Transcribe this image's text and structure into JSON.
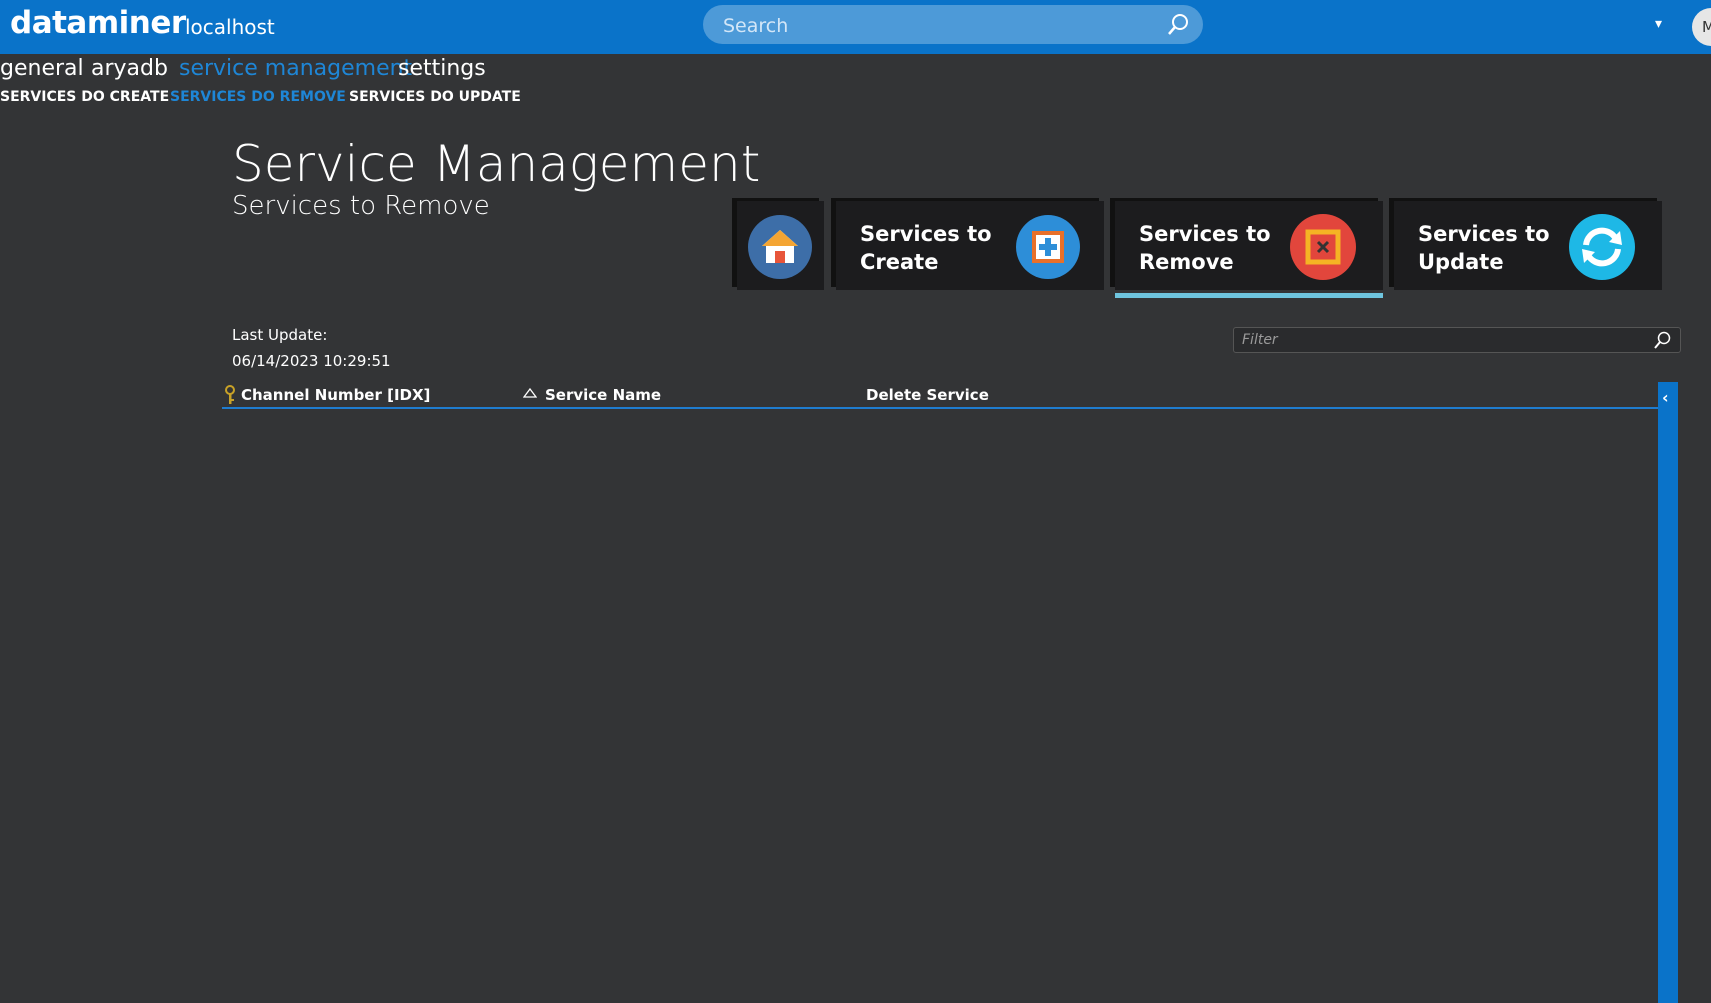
{
  "header": {
    "brand": "dataminer",
    "host": "localhost",
    "search_placeholder": "Search",
    "avatar_initial": "M"
  },
  "nav": {
    "tabs": [
      {
        "label": "general",
        "active": false
      },
      {
        "label": "aryadb",
        "active": false
      },
      {
        "label": "service management",
        "active": true
      },
      {
        "label": "settings",
        "active": false
      }
    ],
    "subtabs": [
      {
        "label": "SERVICES DO CREATE",
        "active": false
      },
      {
        "label": "SERVICES DO REMOVE",
        "active": true
      },
      {
        "label": "SERVICES DO UPDATE",
        "active": false
      }
    ]
  },
  "page": {
    "title": "Service Management",
    "subtitle": "Services to Remove",
    "last_update_label": "Last Update:",
    "last_update_value": "06/14/2023 10:29:51",
    "filter_placeholder": "Filter"
  },
  "tiles": [
    {
      "icon": "home-icon",
      "label": "",
      "selected": false,
      "color": "#3d6ea8"
    },
    {
      "icon": "add-icon",
      "label": "Services to\nCreate",
      "selected": false,
      "color": "#2d8ed8"
    },
    {
      "icon": "remove-icon",
      "label": "Services to\nRemove",
      "selected": true,
      "color": "#e2463c"
    },
    {
      "icon": "refresh-icon",
      "label": "Services to\nUpdate",
      "selected": false,
      "color": "#1eb8e6"
    }
  ],
  "table": {
    "columns": [
      "Channel Number [IDX]",
      "Service Name",
      "Delete Service"
    ],
    "rows": []
  },
  "colors": {
    "topbar": "#0a73c9",
    "background": "#333436",
    "active_tab": "#1e86d6",
    "selected_underline": "#6fc5df"
  }
}
